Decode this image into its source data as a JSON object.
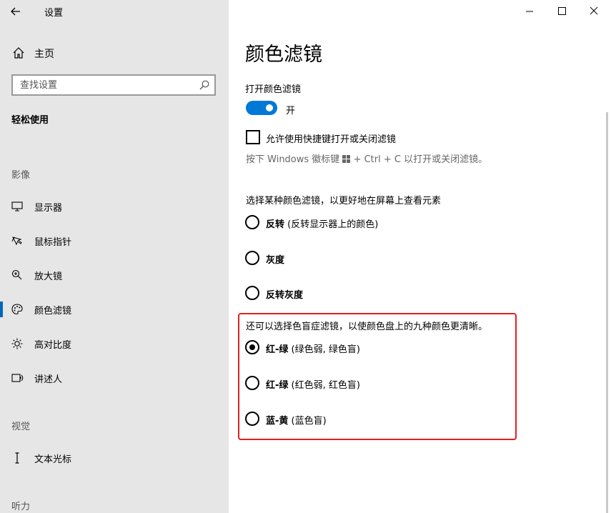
{
  "window": {
    "title": "设置",
    "controls": {
      "minimize": "minimize-icon",
      "maximize": "maximize-icon",
      "close": "close-icon"
    }
  },
  "sidebar": {
    "home_label": "主页",
    "search": {
      "placeholder": "查找设置"
    },
    "group_title": "轻松使用",
    "sections": [
      {
        "title": "影像",
        "items": [
          {
            "label": "显示器",
            "icon": "monitor-icon"
          },
          {
            "label": "鼠标指针",
            "icon": "mouse-pointer-icon"
          },
          {
            "label": "放大镜",
            "icon": "magnifier-icon"
          },
          {
            "label": "颜色滤镜",
            "icon": "palette-icon",
            "selected": true
          },
          {
            "label": "高对比度",
            "icon": "brightness-icon"
          },
          {
            "label": "讲述人",
            "icon": "narrator-icon"
          }
        ]
      },
      {
        "title": "视觉",
        "items": [
          {
            "label": "文本光标",
            "icon": "text-cursor-icon"
          }
        ]
      },
      {
        "title": "听力",
        "items": []
      }
    ]
  },
  "main": {
    "title": "颜色滤镜",
    "toggle": {
      "label": "打开颜色滤镜",
      "state": "开",
      "on": true
    },
    "shortcut_checkbox": {
      "label": "允许使用快捷键打开或关闭滤镜",
      "checked": false,
      "hint_before": "按下 Windows 徽标键 ",
      "hint_after": " + Ctrl + C 以打开或关闭滤镜。"
    },
    "filter_heading": "选择某种颜色滤镜，以更好地在屏幕上查看元素",
    "filters": [
      {
        "name": "反转",
        "desc": " (反转显示器上的颜色)",
        "selected": false
      },
      {
        "name": "灰度",
        "desc": "",
        "selected": false
      },
      {
        "name": "反转灰度",
        "desc": "",
        "selected": false
      }
    ],
    "colorblind_heading": "还可以选择色盲症滤镜，以使颜色盘上的九种颜色更清晰。",
    "colorblind_filters": [
      {
        "name": "红-绿",
        "desc": " (绿色弱, 绿色盲)",
        "selected": true
      },
      {
        "name": "红-绿",
        "desc": " (红色弱, 红色盲)",
        "selected": false
      },
      {
        "name": "蓝-黄",
        "desc": " (蓝色盲)",
        "selected": false
      }
    ]
  },
  "colors": {
    "accent": "#0078d7",
    "sidebar_bg": "#e6e6e6",
    "highlight": "#e02020"
  }
}
